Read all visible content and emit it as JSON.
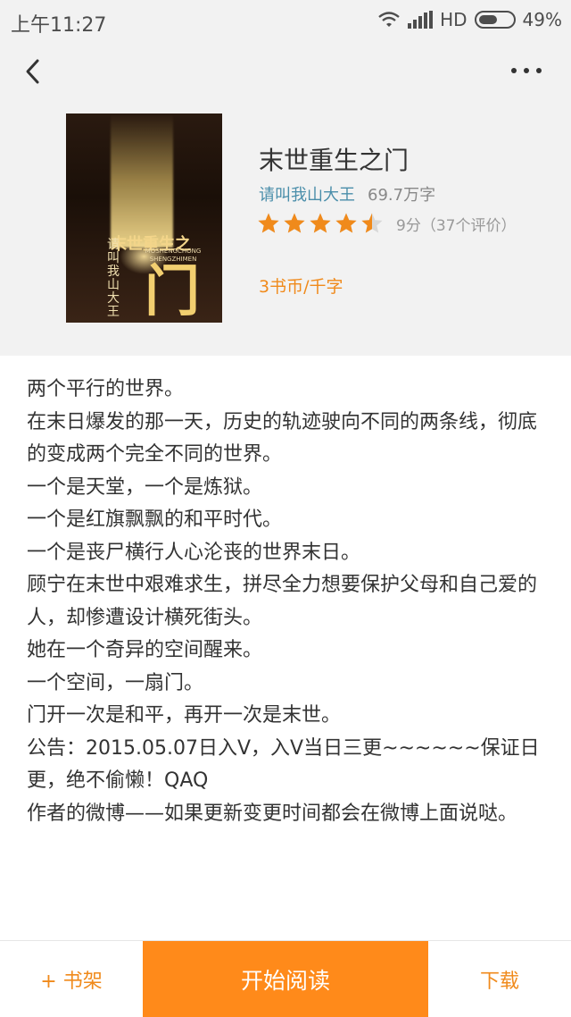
{
  "status_bar": {
    "time": "上午11:27",
    "network": "HD",
    "battery": "49%"
  },
  "nav": {
    "back_icon": "chevron-left-icon",
    "more_icon": "more-dots-icon"
  },
  "book": {
    "title": "末世重生之门",
    "author": "请叫我山大王",
    "word_count": "69.7万字",
    "rating_stars": 4.5,
    "score_text": "9分（37个评价）",
    "price": "3书币/千字",
    "cover": {
      "title": "末世重生之",
      "subtitle": "MOSHENGCHONG SHENGZHIMEN",
      "author": "请叫我山大王",
      "big_char": "门"
    }
  },
  "description": [
    "两个平行的世界。",
    "在末日爆发的那一天，历史的轨迹驶向不同的两条线，彻底的变成两个完全不同的世界。",
    "一个是天堂，一个是炼狱。",
    "一个是红旗飘飘的和平时代。",
    "一个是丧尸横行人心沦丧的世界末日。",
    "顾宁在末世中艰难求生，拼尽全力想要保护父母和自己爱的人，却惨遭设计横死街头。",
    "她在一个奇异的空间醒来。",
    "一个空间，一扇门。",
    "门开一次是和平，再开一次是末世。",
    "公告：2015.05.07日入V，入V当日三更~~~~~~保证日更，绝不偷懒！QAQ",
    "作者的微博——如果更新变更时间都会在微博上面说哒。"
  ],
  "bottom_bar": {
    "shelf_label": "+ 书架",
    "read_label": "开始阅读",
    "download_label": "下载"
  },
  "colors": {
    "accent": "#ff8a1a",
    "author_link": "#4a8eaa",
    "star": "#f08a1b",
    "header_bg": "#f2f2f2"
  }
}
